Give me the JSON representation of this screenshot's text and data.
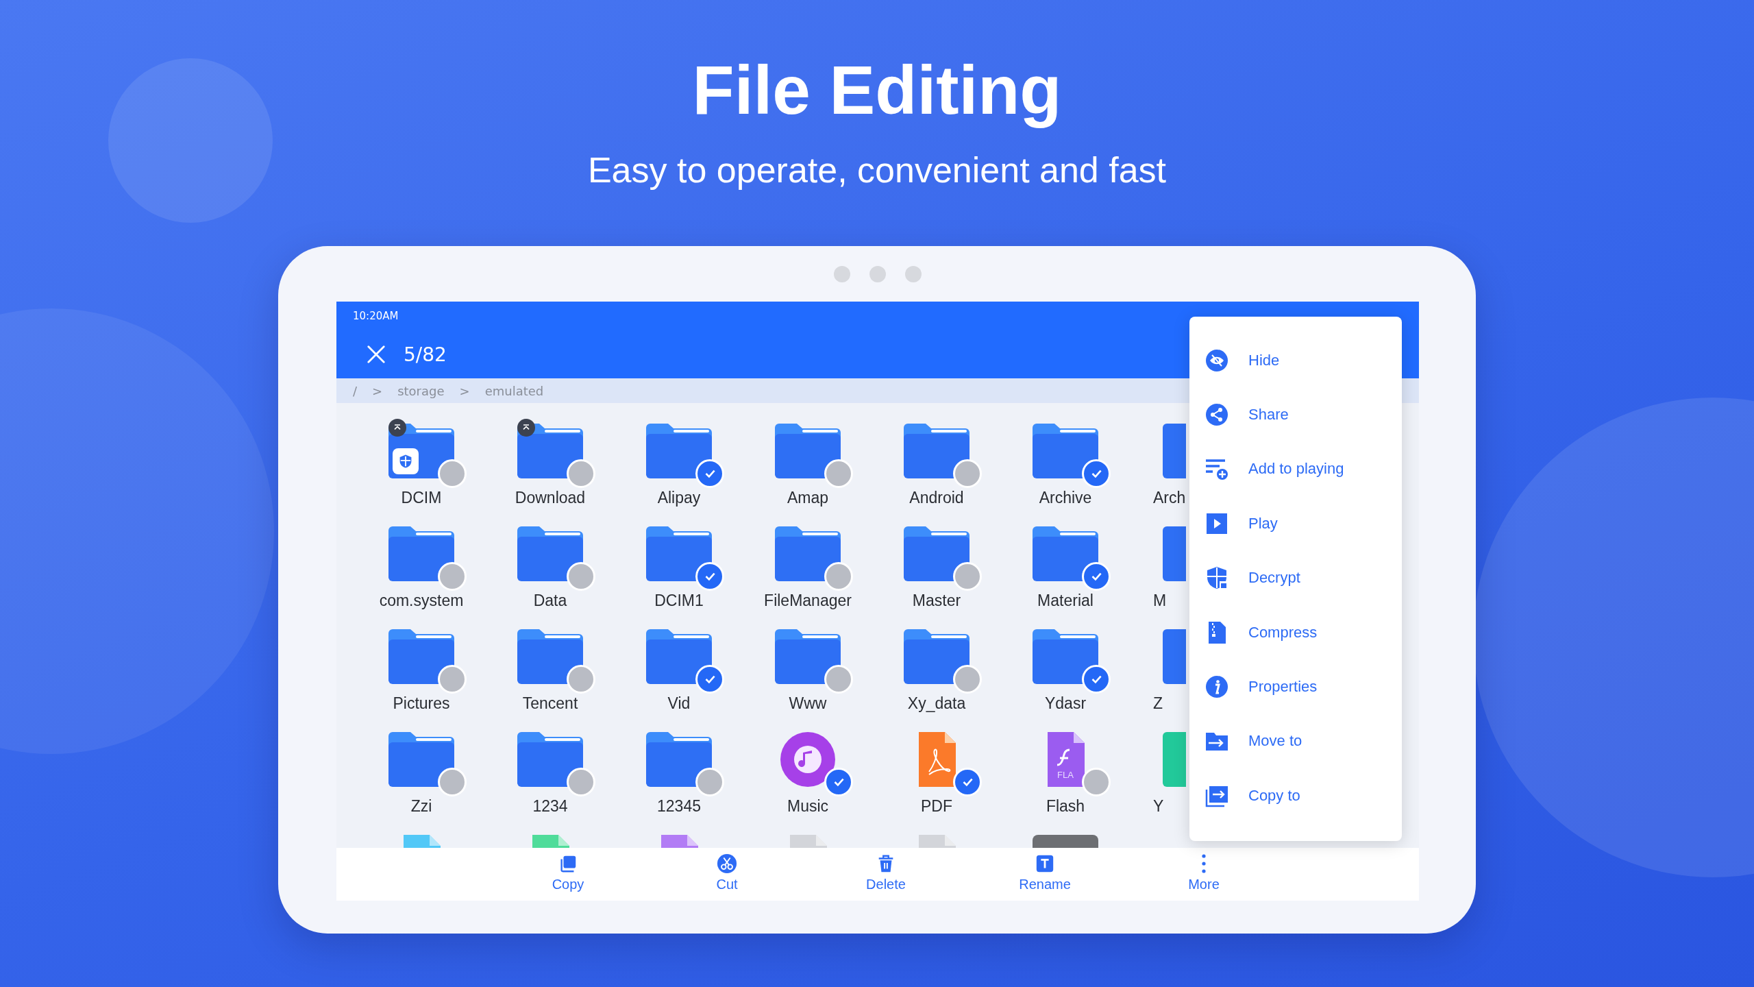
{
  "headline": {
    "title": "File Editing",
    "subtitle": "Easy to operate, convenient and fast"
  },
  "status_bar": {
    "time": "10:20AM"
  },
  "header": {
    "count": "5/82"
  },
  "breadcrumb": [
    "/",
    ">",
    "storage",
    ">",
    "emulated"
  ],
  "files": [
    {
      "label": "DCIM",
      "kind": "folder",
      "checked": false,
      "pinned": true,
      "protected": true
    },
    {
      "label": "Download",
      "kind": "folder",
      "checked": false,
      "pinned": true,
      "protected": false
    },
    {
      "label": "Alipay",
      "kind": "folder",
      "checked": true,
      "pinned": false,
      "protected": false
    },
    {
      "label": "Amap",
      "kind": "folder",
      "checked": false,
      "pinned": false,
      "protected": false
    },
    {
      "label": "Android",
      "kind": "folder",
      "checked": false,
      "pinned": false,
      "protected": false
    },
    {
      "label": "Archive",
      "kind": "folder",
      "checked": true,
      "pinned": false,
      "protected": false
    },
    {
      "label": "com.system",
      "kind": "folder",
      "checked": false,
      "pinned": false,
      "protected": false
    },
    {
      "label": "Data",
      "kind": "folder",
      "checked": false,
      "pinned": false,
      "protected": false
    },
    {
      "label": "DCIM1",
      "kind": "folder",
      "checked": true,
      "pinned": false,
      "protected": false
    },
    {
      "label": "FileManager",
      "kind": "folder",
      "checked": false,
      "pinned": false,
      "protected": false
    },
    {
      "label": "Master",
      "kind": "folder",
      "checked": false,
      "pinned": false,
      "protected": false
    },
    {
      "label": "Material",
      "kind": "folder",
      "checked": true,
      "pinned": false,
      "protected": false
    },
    {
      "label": "Pictures",
      "kind": "folder",
      "checked": false,
      "pinned": false,
      "protected": false
    },
    {
      "label": "Tencent",
      "kind": "folder",
      "checked": false,
      "pinned": false,
      "protected": false
    },
    {
      "label": "Vid",
      "kind": "folder",
      "checked": true,
      "pinned": false,
      "protected": false
    },
    {
      "label": "Www",
      "kind": "folder",
      "checked": false,
      "pinned": false,
      "protected": false
    },
    {
      "label": "Xy_data",
      "kind": "folder",
      "checked": false,
      "pinned": false,
      "protected": false
    },
    {
      "label": "Ydasr",
      "kind": "folder",
      "checked": true,
      "pinned": false,
      "protected": false
    },
    {
      "label": "Zzi",
      "kind": "folder",
      "checked": false,
      "pinned": false,
      "protected": false
    },
    {
      "label": "1234",
      "kind": "folder",
      "checked": false,
      "pinned": false,
      "protected": false
    },
    {
      "label": "12345",
      "kind": "folder",
      "checked": false,
      "pinned": false,
      "protected": false
    },
    {
      "label": "Music",
      "kind": "music",
      "checked": true,
      "pinned": false,
      "protected": false
    },
    {
      "label": "PDF",
      "kind": "pdf",
      "checked": true,
      "pinned": false,
      "protected": false
    },
    {
      "label": "Flash",
      "kind": "flash",
      "icon_text": "FLA",
      "checked": false,
      "pinned": false,
      "protected": false
    }
  ],
  "partly_hidden_files": [
    {
      "label": "Arch",
      "kind": "folder"
    },
    {
      "label": "M",
      "kind": "folder"
    },
    {
      "label": "Z",
      "kind": "folder"
    },
    {
      "label": "Y",
      "kind": "document"
    }
  ],
  "cut_off_row": [
    {
      "kind": "document",
      "color": "#52c8f7"
    },
    {
      "kind": "document",
      "color": "#4fdc9a"
    },
    {
      "kind": "document",
      "color": "#b27cf5"
    },
    {
      "kind": "document",
      "color": "#d3d5da"
    },
    {
      "kind": "document",
      "color": "#d3d5da"
    },
    {
      "kind": "photo"
    }
  ],
  "context_menu": [
    {
      "label": "Hide",
      "kind": "hide"
    },
    {
      "label": "Share",
      "kind": "share"
    },
    {
      "label": "Add to playing",
      "kind": "queue"
    },
    {
      "label": "Play",
      "kind": "play"
    },
    {
      "label": "Decrypt",
      "kind": "decrypt"
    },
    {
      "label": "Compress",
      "kind": "compress"
    },
    {
      "label": "Properties",
      "kind": "properties"
    },
    {
      "label": "Move to",
      "kind": "move"
    },
    {
      "label": "Copy to",
      "kind": "copy"
    }
  ],
  "toolbar": [
    {
      "label": "Copy",
      "kind": "copy"
    },
    {
      "label": "Cut",
      "kind": "cut"
    },
    {
      "label": "Delete",
      "kind": "delete"
    },
    {
      "label": "Rename",
      "kind": "rename"
    },
    {
      "label": "More",
      "kind": "more"
    }
  ]
}
